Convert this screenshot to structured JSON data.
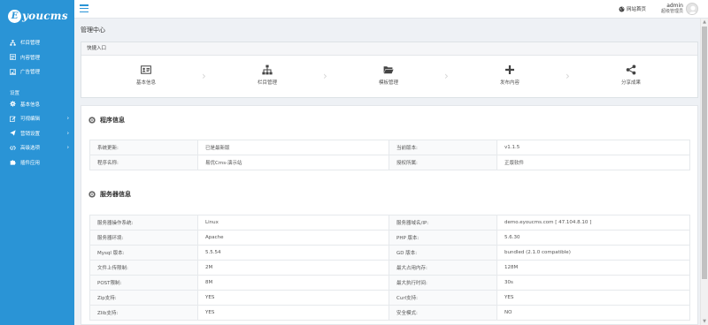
{
  "brand": {
    "logo_letter": "E",
    "logo_text": "youcms"
  },
  "sidebar": {
    "items": [
      {
        "label": "栏目管理",
        "icon": "sitemap-icon"
      },
      {
        "label": "内容管理",
        "icon": "list-icon"
      },
      {
        "label": "广告管理",
        "icon": "image-icon"
      }
    ],
    "section_label": "设置",
    "settings_items": [
      {
        "label": "基本信息",
        "icon": "gear-icon",
        "has_arrow": false
      },
      {
        "label": "可视编辑",
        "icon": "edit-icon",
        "has_arrow": true
      },
      {
        "label": "营销设置",
        "icon": "send-icon",
        "has_arrow": true
      },
      {
        "label": "高级选项",
        "icon": "code-icon",
        "has_arrow": true
      },
      {
        "label": "插件应用",
        "icon": "puzzle-icon",
        "has_arrow": false
      }
    ],
    "arrow_glyph": "›",
    "accent_color": "#2a94d6"
  },
  "header": {
    "site_link": "网站首页",
    "user_name": "admin",
    "user_role": "超级管理员"
  },
  "page": {
    "title": "管理中心"
  },
  "quick_entry": {
    "title": "快捷入口",
    "items": [
      {
        "label": "基本信息",
        "icon": "id-card-icon"
      },
      {
        "label": "栏目管理",
        "icon": "sitemap-icon"
      },
      {
        "label": "模板管理",
        "icon": "folder-open-icon"
      },
      {
        "label": "发布内容",
        "icon": "plus-icon"
      },
      {
        "label": "分享成果",
        "icon": "share-icon"
      }
    ],
    "separator_glyph": "›"
  },
  "program_info": {
    "title": "程序信息",
    "rows": [
      [
        "系统更新:",
        "已是最新版",
        "当前版本:",
        "v1.1.5"
      ],
      [
        "程序名称:",
        "易优Cms-演示站",
        "授权所属:",
        "正版软件"
      ]
    ]
  },
  "server_info": {
    "title": "服务器信息",
    "rows": [
      [
        "服务器操作系统:",
        "Linux",
        "服务器域名/IP:",
        "demo.eyoucms.com [ 47.104.8.10 ]"
      ],
      [
        "服务器环境:",
        "Apache",
        "PHP 版本:",
        "5.6.30"
      ],
      [
        "Mysql 版本:",
        "5.5.54",
        "GD 版本:",
        "bundled (2.1.0 compatible)"
      ],
      [
        "文件上传限制:",
        "2M",
        "最大占用内存:",
        "128M"
      ],
      [
        "POST限制:",
        "8M",
        "最大执行时间:",
        "30s"
      ],
      [
        "Zip支持:",
        "YES",
        "Curl支持:",
        "YES"
      ],
      [
        "Zlib支持:",
        "YES",
        "安全模式:",
        "NO"
      ]
    ]
  },
  "scrollbar": {
    "up_glyph": "▲",
    "down_glyph": "▼"
  }
}
